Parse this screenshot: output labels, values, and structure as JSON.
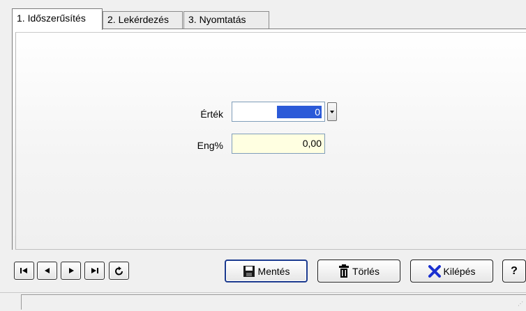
{
  "tabs": [
    {
      "label": "1. Időszerűsítés",
      "active": true
    },
    {
      "label": "2. Lekérdezés",
      "active": false
    },
    {
      "label": "3. Nyomtatás",
      "active": false
    }
  ],
  "form": {
    "value_label": "Érték",
    "value": "0",
    "eng_label": "Eng%",
    "eng_value": "0,00"
  },
  "nav": {
    "first": "first-record-icon",
    "prev": "previous-record-icon",
    "next": "next-record-icon",
    "last": "last-record-icon",
    "refresh": "refresh-icon"
  },
  "buttons": {
    "save_label": "Mentés",
    "delete_label": "Törlés",
    "exit_label": "Kilépés",
    "help_label": "?"
  },
  "colors": {
    "selection": "#2b5ad8",
    "readonly_field": "#ffffe1",
    "exit_icon": "#1a2fd0"
  }
}
